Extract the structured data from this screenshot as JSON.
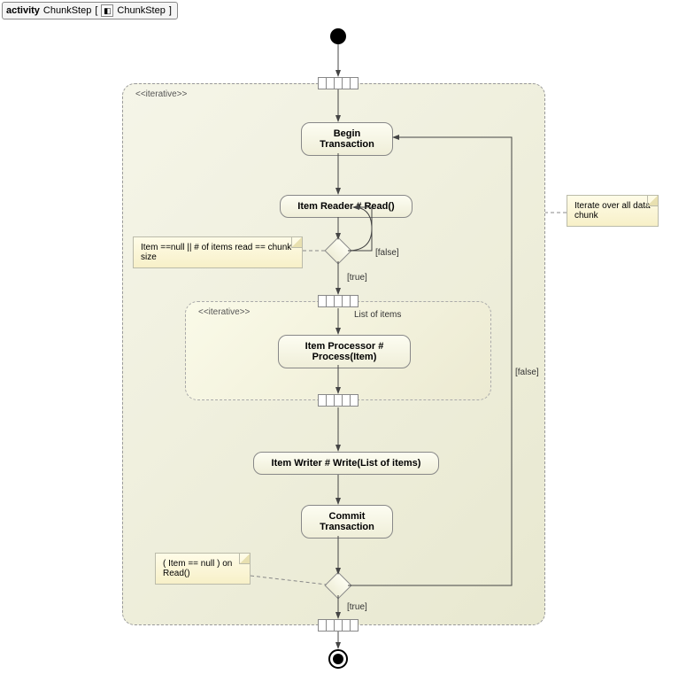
{
  "header": {
    "prefix": "activity",
    "name": "ChunkStep",
    "tabName": "ChunkStep"
  },
  "stereotypes": {
    "outer": "<<iterative>>",
    "inner": "<<iterative>>"
  },
  "nodes": {
    "beginTx": "Begin\nTransaction",
    "read": "Item Reader # Read()",
    "process": "Item Processor #\nProcess(Item)",
    "write": "Item Writer # Write(List of items)",
    "commitTx": "Commit\nTransaction"
  },
  "notes": {
    "readCond": "Item ==null || # of items read == chunk size",
    "iterate": "Iterate over all data chunk",
    "endCond": "( Item == null ) on Read()"
  },
  "guards": {
    "readFalse": "[false]",
    "readTrue": "[true]",
    "endFalse": "[false]",
    "endTrue": "[true]"
  },
  "labels": {
    "listOfItems": "List of items"
  }
}
